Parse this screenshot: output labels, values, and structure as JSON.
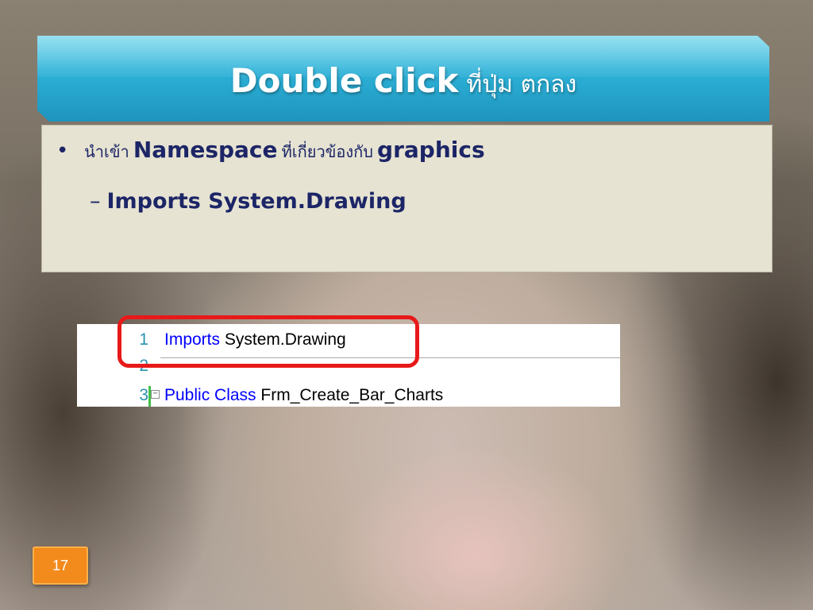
{
  "slide": {
    "title_main": "Double click",
    "title_thai": "ที่ปุ่ม ตกลง",
    "bullet": {
      "prefix": "นำเข้า",
      "term": "Namespace",
      "middle": "ที่เกี่ยวข้องกับ",
      "object": "graphics"
    },
    "sub_bullet": {
      "dash": "–",
      "text": "Imports System.Drawing"
    },
    "code_lines": [
      {
        "number": "1",
        "keyword": "Imports",
        "text": "System.Drawing"
      },
      {
        "number": "2",
        "keyword": "",
        "text": ""
      },
      {
        "number": "3",
        "keyword": "Public Class",
        "text": "Frm_Create_Bar_Charts"
      }
    ],
    "collapse_glyph": "−",
    "page_number": "17"
  }
}
